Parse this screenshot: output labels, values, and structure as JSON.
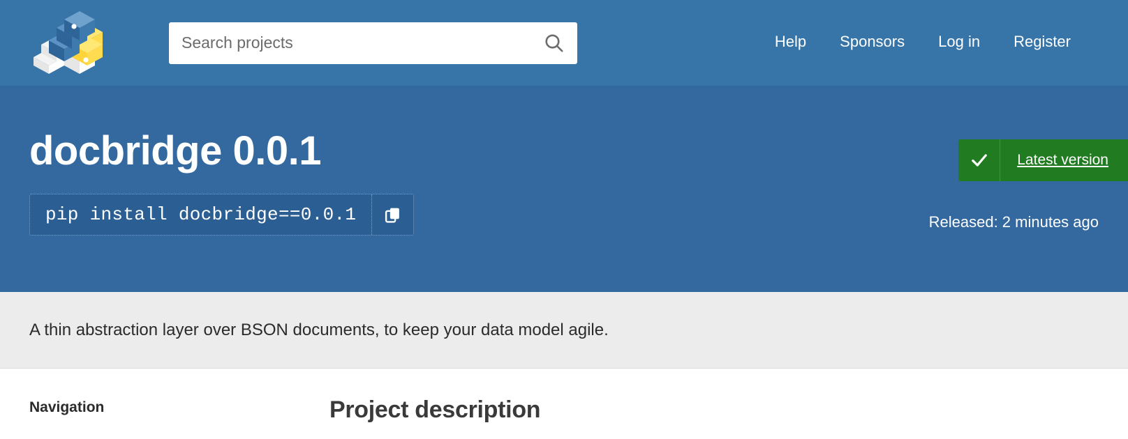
{
  "header": {
    "logo_name": "pypi-logo",
    "search": {
      "placeholder": "Search projects",
      "value": "",
      "icon": "search-icon"
    },
    "nav": [
      {
        "label": "Help"
      },
      {
        "label": "Sponsors"
      },
      {
        "label": "Log in"
      },
      {
        "label": "Register"
      }
    ]
  },
  "project": {
    "title": "docbridge 0.0.1",
    "pip_command": "pip install docbridge==0.0.1",
    "copy_icon": "copy-icon",
    "status": {
      "check_icon": "check-icon",
      "label": "Latest version"
    },
    "released": "Released: 2 minutes ago",
    "summary": "A thin abstraction layer over BSON documents, to keep your data model agile."
  },
  "body": {
    "navigation_heading": "Navigation",
    "description_heading": "Project description"
  },
  "colors": {
    "header_blue": "#3775A9",
    "banner_blue": "#33699F",
    "pip_box_blue": "#2B5E93",
    "badge_green": "#217C21",
    "strip_gray": "#ECECEC",
    "logo_yellow": "#FFD43B",
    "logo_blue": "#376F9F"
  }
}
